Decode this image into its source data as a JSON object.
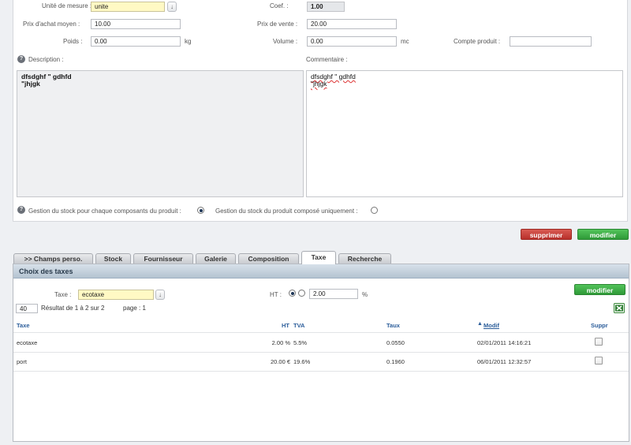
{
  "product": {
    "unit_label": "Unité de mesure :",
    "unit_value": "unite",
    "coef_label": "Coef. :",
    "coef_value": "1.00",
    "purchase_label": "Prix d'achat moyen :",
    "purchase_value": "10.00",
    "sale_label": "Prix de vente :",
    "sale_value": "20.00",
    "weight_label": "Poids :",
    "weight_value": "0.00",
    "weight_unit": "kg",
    "volume_label": "Volume :",
    "volume_value": "0.00",
    "volume_unit": "mc",
    "account_label": "Compte produit :",
    "account_value": "",
    "description_label": "Description :",
    "description_line1": "dfsdghf \" gdhfd",
    "description_line2": "\"jhjgk",
    "comment_label": "Commentaire :",
    "comment_line1": "dfsdghf \" gdhfd",
    "comment_line2": "\"jhjgk",
    "stock_each_label": "Gestion du stock pour chaque composants du produit :",
    "stock_composite_label": "Gestion du stock du produit composé uniquement :",
    "help_glyph": "?",
    "dropdown_glyph": "↓"
  },
  "actions": {
    "delete_label": "supprimer",
    "modify_label": "modifier"
  },
  "tabs": [
    {
      "label": ">> Champs perso."
    },
    {
      "label": "Stock"
    },
    {
      "label": "Fournisseur"
    },
    {
      "label": "Galerie"
    },
    {
      "label": "Composition"
    },
    {
      "label": "Taxe"
    },
    {
      "label": "Recherche"
    }
  ],
  "tax_panel": {
    "title": "Choix des taxes",
    "tax_label": "Taxe :",
    "tax_value": "ecotaxe",
    "ht_label": "HT :",
    "rate_value": "2.00",
    "percent": "%",
    "modify_label": "modifier",
    "per_page": "40",
    "result_text": "Résultat de 1 à 2 sur 2",
    "page_text": "page : 1",
    "columns": {
      "taxe": "Taxe",
      "ht": "HT",
      "tva": "TVA",
      "taux": "Taux",
      "modif": "Modif",
      "suppr": "Suppr"
    },
    "rows": [
      {
        "taxe": "ecotaxe",
        "ht": "2.00 %",
        "tva": "5.5%",
        "taux": "0.0550",
        "modif": "02/01/2011 14:16:21"
      },
      {
        "taxe": "port",
        "ht": "20.00 €",
        "tva": "19.6%",
        "taux": "0.1960",
        "modif": "06/01/2011 12:32:57"
      }
    ]
  },
  "colors": {
    "accent_green": "#2f9a38",
    "accent_red": "#b8302b",
    "link_blue": "#2b5d9a"
  }
}
